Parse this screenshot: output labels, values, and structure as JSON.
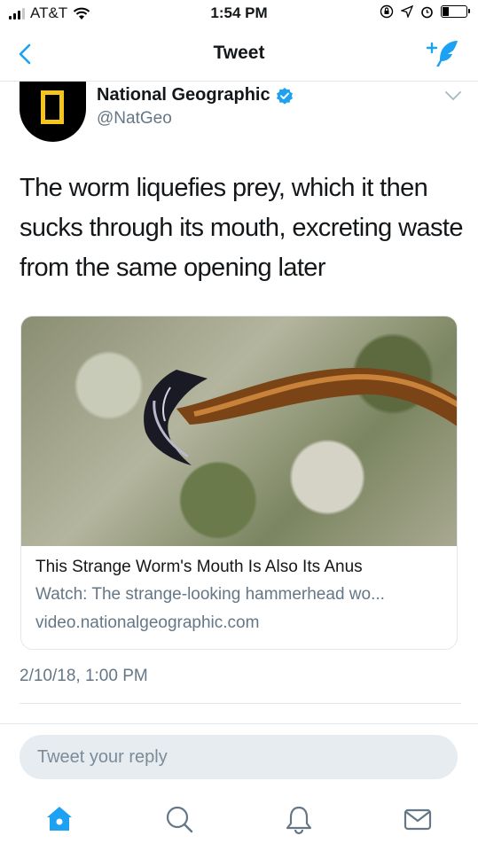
{
  "status_bar": {
    "carrier": "AT&T",
    "time": "1:54 PM",
    "signal_bars": 3,
    "battery_level": 0.25
  },
  "nav": {
    "title": "Tweet",
    "back_icon": "chevron-left-icon",
    "compose_icon": "compose-tweet-icon",
    "accent_color": "#1da1f2"
  },
  "tweet": {
    "author_name": "National Geographic",
    "author_handle": "@NatGeo",
    "verified": true,
    "text": "The worm liquefies prey, which it then sucks through its mouth, excreting waste from the same opening later",
    "timestamp": "2/10/18, 1:00 PM"
  },
  "card": {
    "title": "This Strange Worm's Mouth Is Also Its Anus",
    "description": "Watch: The strange-looking hammerhead wo...",
    "domain": "video.nationalgeographic.com"
  },
  "reply": {
    "placeholder": "Tweet your reply"
  },
  "tab_bar": {
    "tabs": [
      "home-icon",
      "search-icon",
      "notifications-icon",
      "messages-icon"
    ],
    "active_tab": "home-icon"
  }
}
